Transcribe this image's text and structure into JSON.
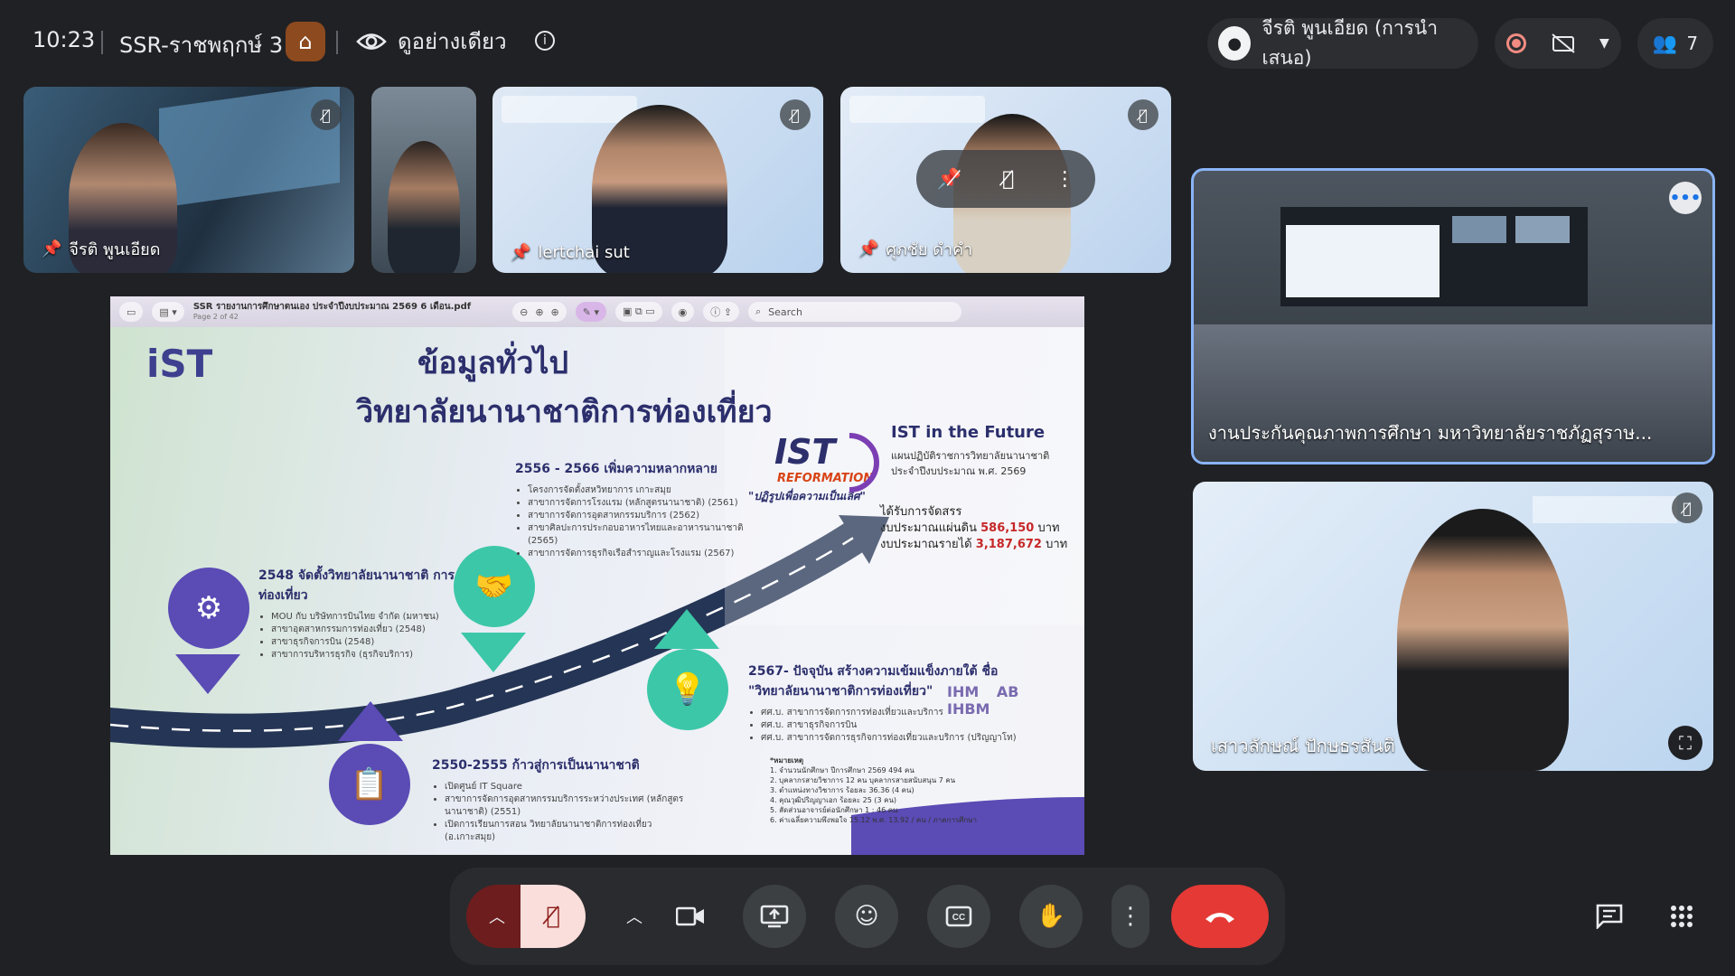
{
  "topbar": {
    "time": "10:23",
    "meeting_title": "SSR-ราชพฤกษ์ 3",
    "view_only_label": "ดูอย่างเดียว",
    "presenter_name": "จีรติ พูนเอียด (การนำเสนอ)",
    "participant_count": "7"
  },
  "tiles": [
    {
      "name": "จีรติ พูนเอียด"
    },
    {
      "name": ""
    },
    {
      "name": "lertchai sut"
    },
    {
      "name": "ศุภชัย ดำคำ"
    },
    {
      "name": "งานประกันคุณภาพการศึกษา มหาวิทยาลัยราชภัฏสุราษ..."
    },
    {
      "name": "เสาวลักษณ์ ปักษธรสันติ"
    }
  ],
  "pdf": {
    "filename": "SSR รายงานการศึกษาตนเอง ประจำปีงบประมาณ 2569 6 เดือน.pdf",
    "page_label": "Page 2 of 42",
    "search_placeholder": "Search"
  },
  "slide": {
    "logo_text": "iST",
    "heading1": "ข้อมูลทั่วไป",
    "heading2": "วิทยาลัยนานาชาติการท่องเที่ยว",
    "milestones": [
      {
        "title": "2548 จัดตั้งวิทยาลัยนานาชาติ การท่องเที่ยว",
        "bullets": [
          "MOU กับ บริษัทการบินไทย จำกัด (มหาชน)",
          "สาขาอุตสาหกรรมการท่องเที่ยว (2548)",
          "สาขาธุรกิจการบิน (2548)",
          "สาขาการบริหารธุรกิจ (ธุรกิจบริการ)"
        ]
      },
      {
        "title": "2550-2555 ก้าวสู่การเป็นนานาชาติ",
        "bullets": [
          "เปิดศูนย์ IT Square",
          "สาขาการจัดการอุตสาหกรรมบริการระหว่างประเทศ (หลักสูตรนานาชาติ) (2551)",
          "เปิดการเรียนการสอน วิทยาลัยนานาชาติการท่องเที่ยว (อ.เกาะสมุย)"
        ]
      },
      {
        "title": "2556 - 2566 เพิ่มความหลากหลาย",
        "bullets": [
          "โครงการจัดตั้งสหวิทยาการ เกาะสมุย",
          "สาขาการจัดการโรงแรม (หลักสูตรนานาชาติ) (2561)",
          "สาขาการจัดการอุตสาหกรรมบริการ (2562)",
          "สาขาศิลปะการประกอบอาหารไทยและอาหารนานาชาติ (2565)",
          "สาขาการจัดการธุรกิจเรือสำราญและโรงแรม (2567)"
        ]
      },
      {
        "title": "2567- ปัจจุบัน สร้างความเข้มแข็งภายใต้ ชื่อ \"วิทยาลัยนานาชาติการท่องเที่ยว\"",
        "bullets": [
          "ศศ.บ. สาขาการจัดการการท่องเที่ยวและบริการ",
          "ศศ.บ. สาขาธุรกิจการบิน",
          "ศศ.บ. สาขาการจัดการธุรกิจการท่องเที่ยวและบริการ (ปริญญาโท)"
        ]
      }
    ],
    "reform_title": "IST",
    "reform_word": "REFORMATION",
    "reform_tagline": "\"ปฏิรูปเพื่อความเป็นเลิศ\"",
    "future_title": "IST in the Future",
    "future_sub": "แผนปฏิบัติราชการวิทยาลัยนานาชาติ ประจำปีงบประมาณ พ.ศ. 2569",
    "budget_heading": "ได้รับการจัดสรร",
    "budget_state_label": "งบประมาณแผ่นดิน",
    "budget_state_value": "586,150",
    "budget_income_label": "งบประมาณรายได้",
    "budget_income_value": "3,187,672",
    "budget_unit": "บาท",
    "brand_logos": [
      "IHM",
      "AB",
      "IHBM"
    ],
    "notes_title": "*หมายเหตุ",
    "notes": [
      "1. จำนวนนักศึกษา ปีการศึกษา 2569 494 คน",
      "2. บุคลากรสายวิชาการ 12 คน บุคลากรสายสนับสนุน 7 คน",
      "3. ตำแหน่งทางวิชาการ ร้อยละ 36.36 (4 คน)",
      "4. คุณวุฒิปริญญาเอก ร้อยละ 25 (3 คน)",
      "5. สัดส่วนอาจารย์ต่อนักศึกษา 1 : 46 คน",
      "6. ค่าเฉลี่ยความพึงพอใจ 15.12 พ.ศ. 13.92 / คน / ภาคการศึกษา"
    ]
  },
  "colors": {
    "background": "#202124",
    "end_call": "#e53935",
    "mic_off_bg": "#f9dedc",
    "slide_navy": "#2c2f6c",
    "slide_purple": "#5a4bb5",
    "slide_teal": "#3cc7a8"
  },
  "icons": [
    "eye-icon",
    "info-icon",
    "record-icon",
    "no-camera-icon",
    "people-icon",
    "mic-off-icon",
    "camera-icon",
    "present-icon",
    "emoji-icon",
    "captions-icon",
    "hand-icon",
    "more-icon",
    "end-call-icon",
    "chat-icon",
    "apps-icon"
  ]
}
